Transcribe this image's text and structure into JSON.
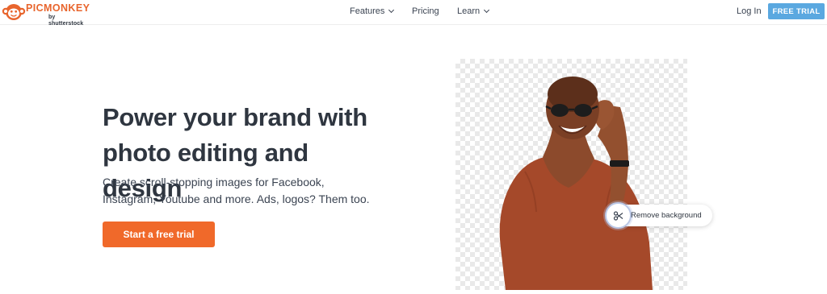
{
  "brand": {
    "name": "PICMONKEY",
    "byline": "by shutterstock",
    "accent": "#e8652d"
  },
  "nav": {
    "items": [
      {
        "label": "Features",
        "has_dropdown": true
      },
      {
        "label": "Pricing",
        "has_dropdown": false
      },
      {
        "label": "Learn",
        "has_dropdown": true
      }
    ],
    "login_label": "Log In",
    "trial_label": "FREE TRIAL",
    "trial_color": "#5aa8e0"
  },
  "hero": {
    "headline_line1": "Power your brand with",
    "headline_line2": "photo editing and design",
    "subtext_line1": "Create scroll-stopping images for Facebook,",
    "subtext_line2": "Instagram, Youtube and more. Ads, logos? Them too.",
    "cta_label": "Start a free trial",
    "cta_color": "#f0692a"
  },
  "image_callout": {
    "label": "Remove background",
    "icon": "scissors-icon"
  }
}
